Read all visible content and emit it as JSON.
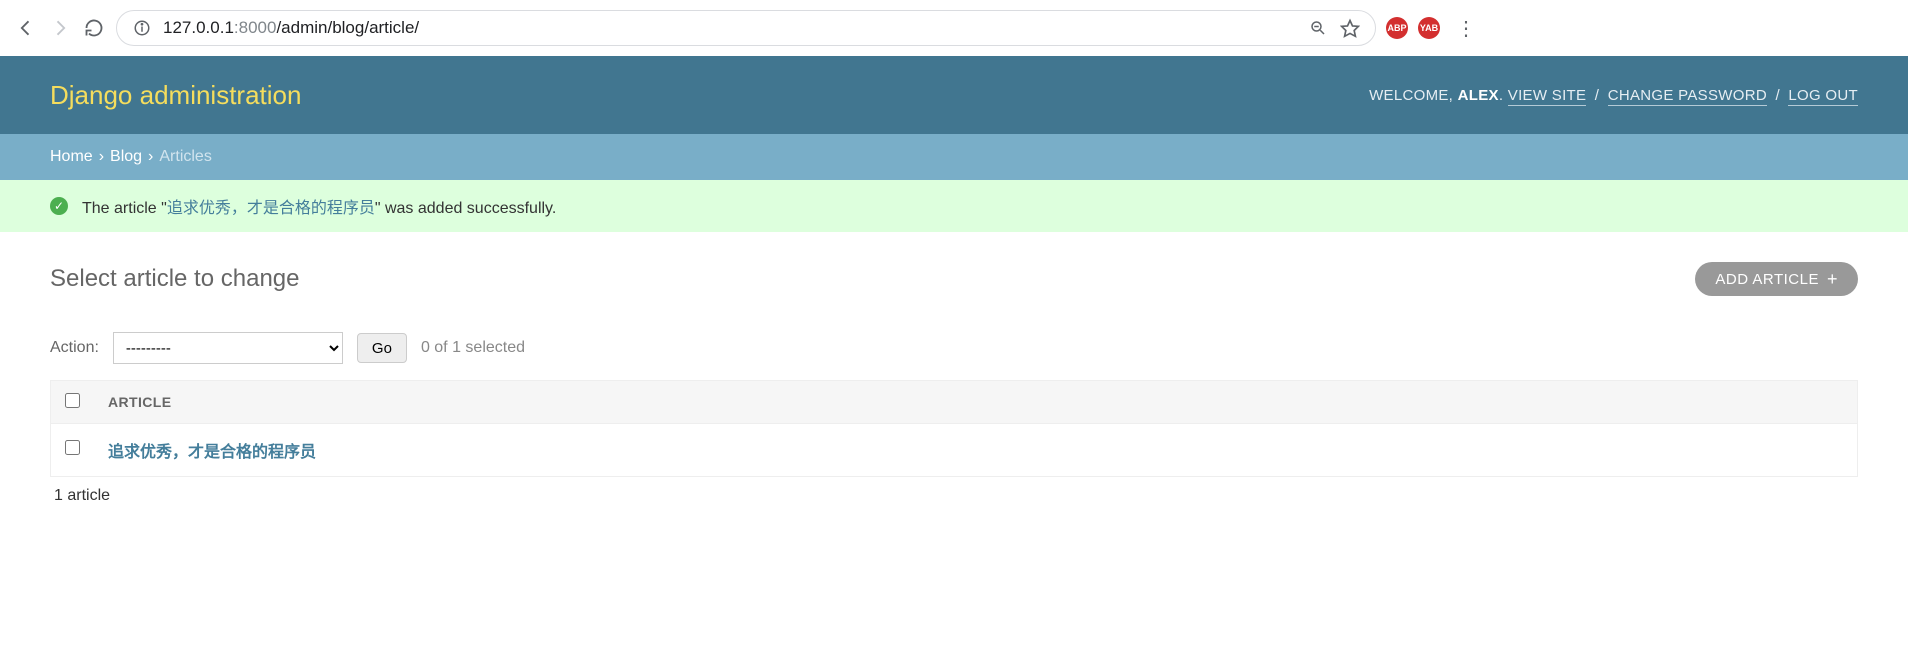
{
  "browser": {
    "url_host": "127.0.0.1",
    "url_port": ":8000",
    "url_path": "/admin/blog/article/",
    "ext1": "ABP",
    "ext2": "YAB"
  },
  "header": {
    "title": "Django administration",
    "welcome": "WELCOME, ",
    "username": "ALEX",
    "view_site": "VIEW SITE",
    "change_password": "CHANGE PASSWORD",
    "logout": "LOG OUT"
  },
  "breadcrumbs": {
    "home": "Home",
    "blog": "Blog",
    "current": "Articles"
  },
  "message": {
    "prefix": "The article \"",
    "object": "追求优秀，才是合格的程序员",
    "suffix": "\" was added successfully."
  },
  "content": {
    "heading": "Select article to change",
    "add_label": "ADD ARTICLE",
    "action_label": "Action:",
    "action_placeholder": "---------",
    "go_label": "Go",
    "selection_count": "0 of 1 selected",
    "column_header": "ARTICLE",
    "rows": [
      {
        "title": "追求优秀，才是合格的程序员"
      }
    ],
    "count_text": "1 article"
  }
}
